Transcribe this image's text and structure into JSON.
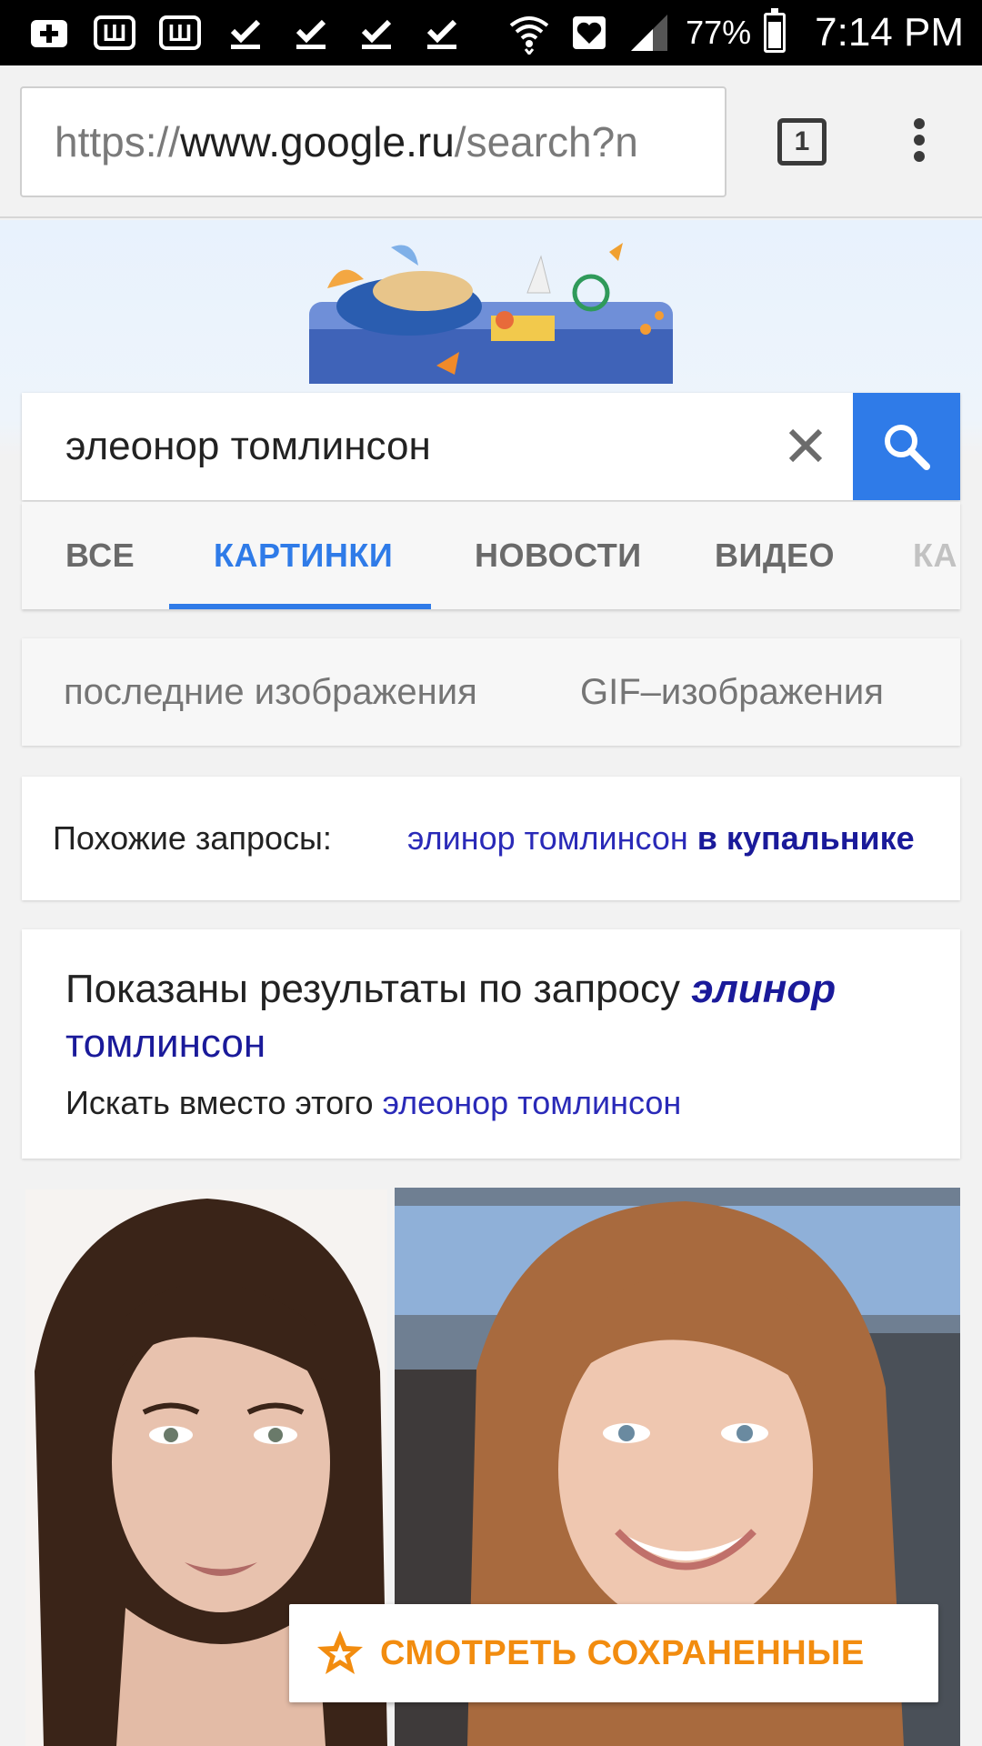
{
  "status_bar": {
    "battery_percent": "77%",
    "battery_level": 0.77,
    "time": "7:14 PM",
    "icons": [
      "add-icon",
      "w-app-icon",
      "w-app-icon",
      "download-done-icon",
      "download-done-icon",
      "download-done-icon",
      "download-done-icon",
      "wifi-icon",
      "heart-icon",
      "signal-icon",
      "battery-icon"
    ]
  },
  "browser": {
    "url_scheme": "https://",
    "url_host": "www.google.ru",
    "url_path": "/search?n",
    "tab_count": "1"
  },
  "search": {
    "query": "элеонор томлинсон"
  },
  "tabs": [
    {
      "label": "ВСЕ",
      "active": false
    },
    {
      "label": "КАРТИНКИ",
      "active": true
    },
    {
      "label": "НОВОСТИ",
      "active": false
    },
    {
      "label": "ВИДЕО",
      "active": false
    },
    {
      "label": "КА",
      "active": false
    }
  ],
  "chips": [
    "последние изображения",
    "GIF–изображения"
  ],
  "related": {
    "label": "Похожие запросы:",
    "link_plain": "элинор томлинсон",
    "link_bold": "в купальнике"
  },
  "correction": {
    "shown_prefix": "Показаны результаты по запросу",
    "shown_query_part1": "элинор",
    "shown_query_part2": "томлинсон",
    "instead_prefix": "Искать вместо этого",
    "instead_query": "элеонор томлинсон"
  },
  "saved_button": {
    "label": "СМОТРЕТЬ СОХРАНЕННЫЕ"
  },
  "colors": {
    "accent_blue": "#2f7be8",
    "link_blue": "#2a2ab8",
    "saved_orange": "#f28c0f"
  }
}
